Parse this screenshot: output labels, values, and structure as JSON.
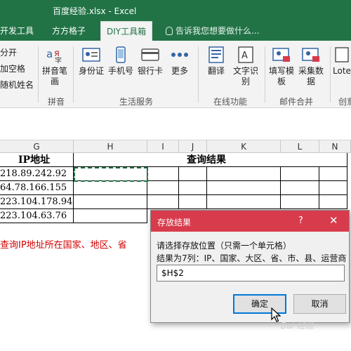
{
  "window": {
    "title": "百度经验.xlsx - Excel"
  },
  "tabs": [
    {
      "label": "开发工具"
    },
    {
      "label": "方方格子"
    },
    {
      "label": "DIY工具箱"
    }
  ],
  "tell_me": "告诉我您想要做什么...",
  "ribbon": {
    "left_items": [
      "分开",
      "加空格",
      "随机姓名"
    ],
    "buttons": [
      {
        "label": "拼音笔画",
        "icon": "pinyin-icon"
      },
      {
        "label": "身份证",
        "icon": "id-card-icon"
      },
      {
        "label": "手机号",
        "icon": "phone-icon"
      },
      {
        "label": "银行卡",
        "icon": "bank-card-icon"
      },
      {
        "label": "更多",
        "icon": "more-icon"
      },
      {
        "label": "翻译",
        "icon": "translate-icon"
      },
      {
        "label": "文字识别",
        "icon": "ocr-icon"
      },
      {
        "label": "填写模板",
        "icon": "fill-template-icon"
      },
      {
        "label": "采集数据",
        "icon": "collect-data-icon"
      },
      {
        "label": "Lote",
        "icon": "lottery-icon"
      }
    ],
    "groups": [
      "拼音",
      "生活服务",
      "在线功能",
      "邮件合并",
      "创意"
    ]
  },
  "sheet": {
    "columns": [
      "G",
      "H",
      "I",
      "J",
      "K",
      "L",
      "N"
    ],
    "header_ip": "IP地址",
    "header_result": "查询结果",
    "ips": [
      "218.89.242.92",
      "64.78.166.155",
      "223.104.178.94",
      "223.104.63.76"
    ],
    "note": "查询IP地址所在国家、地区、省"
  },
  "dialog": {
    "title": "存放结果",
    "help": "?",
    "close": "✕",
    "prompt": "请选择存放位置（只需一个单元格）",
    "info": "结果为7列：IP、国家、大区、省、市、县、运营商",
    "value": "$H$2",
    "ok": "确定",
    "cancel": "取消"
  },
  "watermark": "Bai 经验",
  "colors": {
    "excel_green": "#217346",
    "dialog_red": "#d83b4b",
    "note_red": "#d00000"
  }
}
